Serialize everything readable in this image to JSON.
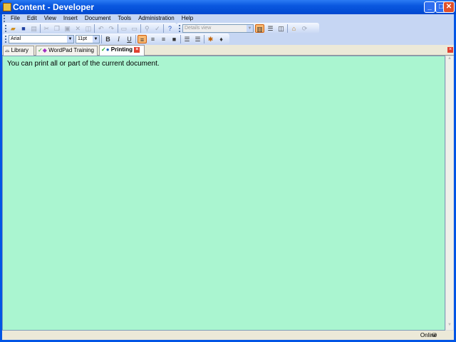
{
  "window": {
    "title": "Content - Developer"
  },
  "menu": [
    "File",
    "Edit",
    "View",
    "Insert",
    "Document",
    "Tools",
    "Administration",
    "Help"
  ],
  "toolbar": {
    "view_select": "Details view"
  },
  "format": {
    "font": "Arial",
    "size": "11pt",
    "bold": "B",
    "italic": "I",
    "underline": "U"
  },
  "tabs": [
    {
      "label": "Library"
    },
    {
      "label": "WordPad Training"
    },
    {
      "label": "Printing"
    }
  ],
  "document": {
    "text": "You can print all or part of the current document."
  },
  "status": {
    "text": "Online"
  }
}
